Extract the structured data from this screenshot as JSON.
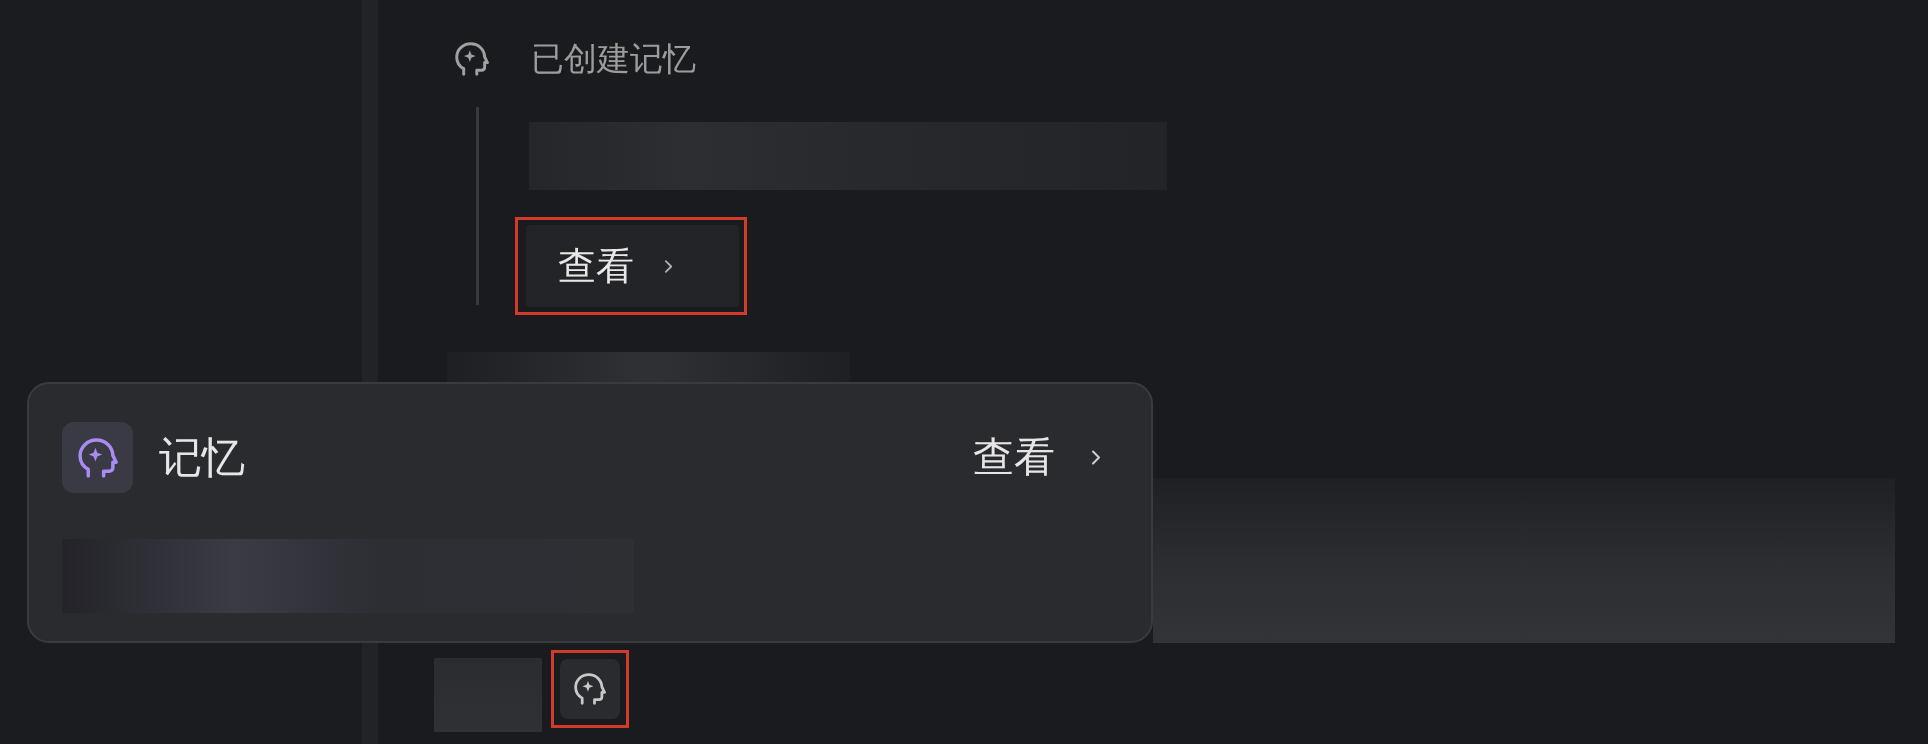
{
  "memory_log": {
    "title": "已创建记忆",
    "view_button": {
      "label": "查看",
      "highlighted": true
    }
  },
  "memory_card": {
    "title": "记忆",
    "view_link": "查看"
  },
  "memory_icon_button": {
    "highlighted": true
  }
}
